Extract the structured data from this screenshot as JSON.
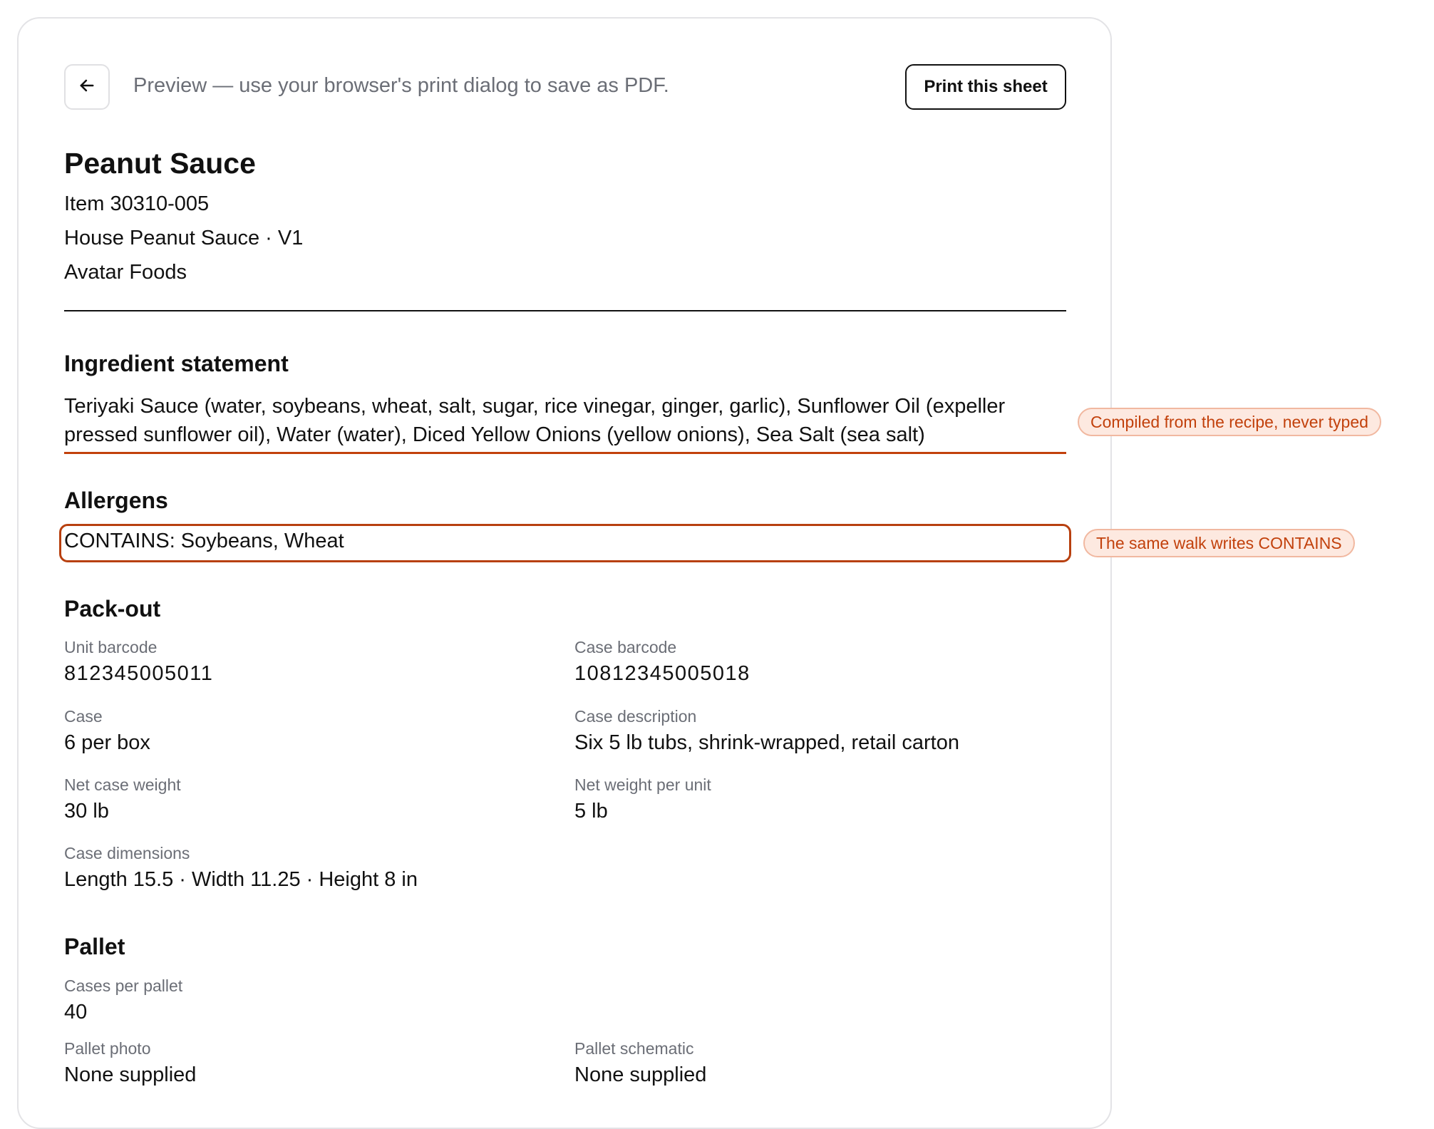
{
  "header": {
    "preview_note": "Preview — use your browser's print dialog to save as PDF.",
    "print_button_label": "Print this sheet"
  },
  "product": {
    "title": "Peanut Sauce",
    "item": "Item 30310-005",
    "recipe": "House Peanut Sauce · V1",
    "company": "Avatar Foods"
  },
  "ingredients": {
    "heading": "Ingredient statement",
    "statement": "Teriyaki Sauce (water, soybeans, wheat, salt, sugar, rice vinegar, ginger, garlic), Sunflower Oil (expeller pressed sunflower oil), Water (water), Diced Yellow Onions (yellow onions), Sea Salt (sea salt)",
    "note": "Compiled from the recipe, never typed"
  },
  "allergens": {
    "heading": "Allergens",
    "statement": "CONTAINS: Soybeans, Wheat",
    "note": "The same walk writes CONTAINS"
  },
  "packout": {
    "heading": "Pack-out",
    "unit_barcode_label": "Unit barcode",
    "unit_barcode": "812345005011",
    "case_barcode_label": "Case barcode",
    "case_barcode": "10812345005018",
    "case_label": "Case",
    "case": "6 per box",
    "case_description_label": "Case description",
    "case_description": "Six 5 lb tubs, shrink-wrapped, retail carton",
    "net_case_weight_label": "Net case weight",
    "net_case_weight": "30 lb",
    "net_weight_per_unit_label": "Net weight per unit",
    "net_weight_per_unit": "5 lb",
    "case_dimensions_label": "Case dimensions",
    "case_dimensions": "Length 15.5 · Width 11.25 · Height 8 in"
  },
  "pallet": {
    "heading": "Pallet",
    "cases_per_pallet_label": "Cases per pallet",
    "cases_per_pallet": "40",
    "pallet_photo_label": "Pallet photo",
    "pallet_photo": "None supplied",
    "pallet_schematic_label": "Pallet schematic",
    "pallet_schematic": "None supplied"
  },
  "colors": {
    "accent": "#c2410c",
    "note_background": "#fde9e0",
    "muted_text": "#6b6e76"
  },
  "icons": {
    "back": "arrow-left-icon"
  }
}
